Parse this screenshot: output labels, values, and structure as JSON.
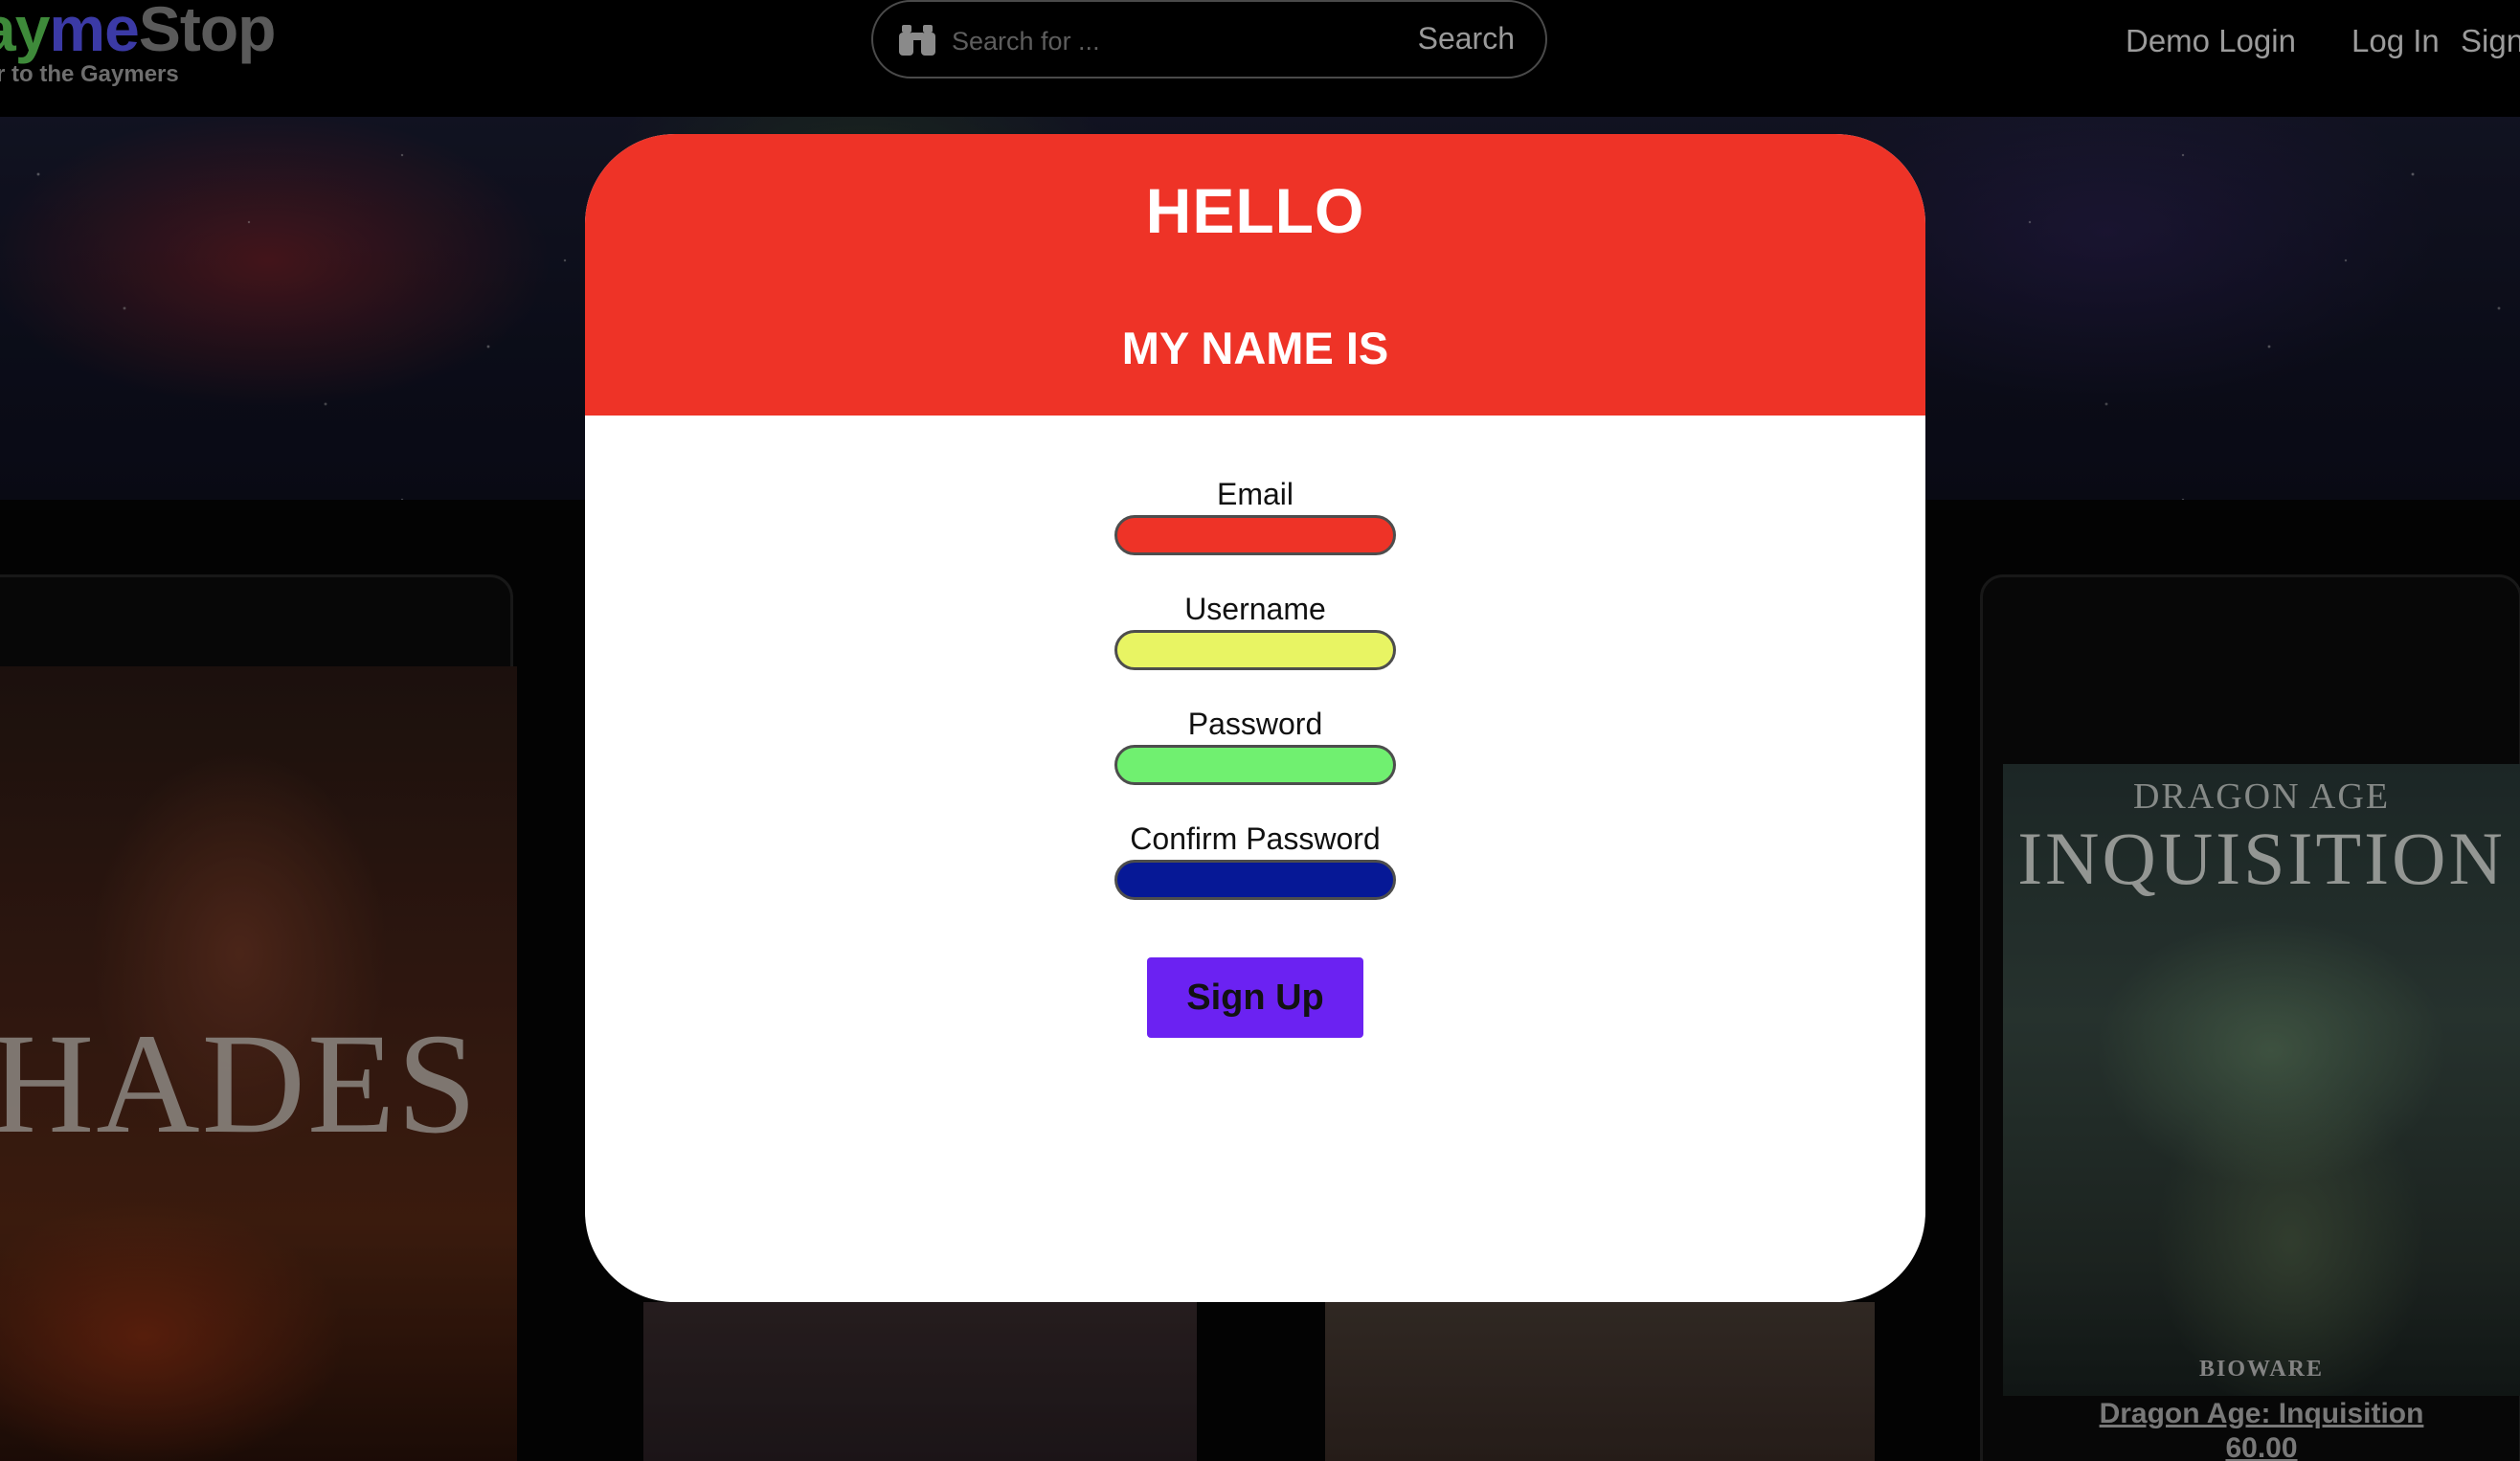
{
  "nav": {
    "logo_part1": "ay",
    "logo_part2": "me",
    "logo_part3": "Stop",
    "tagline": "r to the Gaymers",
    "search_placeholder": "Search for ...",
    "search_button": "Search",
    "demo_login": "Demo Login",
    "log_in": "Log In",
    "sign_up": "Sign"
  },
  "modal": {
    "hello": "HELLO",
    "my_name_is": "MY NAME IS",
    "fields": [
      {
        "label": "Email",
        "value": "",
        "color": "#ee3327"
      },
      {
        "label": "Username",
        "value": "",
        "color": "#e8f463"
      },
      {
        "label": "Password",
        "value": "",
        "color": "#70f070"
      },
      {
        "label": "Confirm Password",
        "value": "",
        "color": "#061896"
      }
    ],
    "submit_label": "Sign Up",
    "submit_color": "#6b22f2"
  },
  "background": {
    "hades_art_title": "HADES",
    "dai_art_subtitle": "DRAGON AGE",
    "dai_art_title": "INQUISITION",
    "dai_art_publisher": "BIOWARE",
    "dai_game_title": "Dragon Age: Inquisition",
    "dai_price": "60.00"
  },
  "colors": {
    "header_red": "#ee3327",
    "page_background": "#000000"
  }
}
